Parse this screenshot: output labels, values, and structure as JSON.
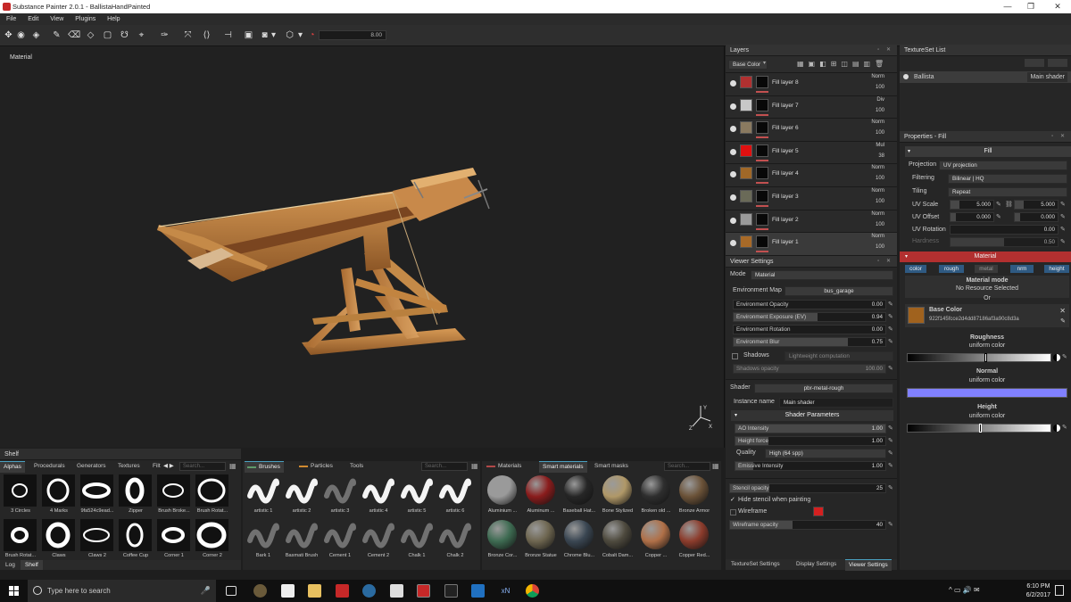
{
  "window": {
    "title": "Substance Painter 2.0.1 - BallistaHandPainted"
  },
  "menu": [
    "File",
    "Edit",
    "View",
    "Plugins",
    "Help"
  ],
  "toolbar": {
    "slider_value": "8.00"
  },
  "viewport": {
    "label": "Material"
  },
  "layers": {
    "title": "Layers",
    "channel": "Base Color",
    "items": [
      {
        "name": "Fill layer 8",
        "blend": "Norm",
        "opacity": "100",
        "color": "#b03030"
      },
      {
        "name": "Fill layer 7",
        "blend": "Div",
        "opacity": "100",
        "color": "#c8c8c8"
      },
      {
        "name": "Fill layer 6",
        "blend": "Norm",
        "opacity": "100",
        "color": "#8a7a60"
      },
      {
        "name": "Fill layer 5",
        "blend": "Mul",
        "opacity": "38",
        "color": "#e01010"
      },
      {
        "name": "Fill layer 4",
        "blend": "Norm",
        "opacity": "100",
        "color": "#a06828"
      },
      {
        "name": "Fill layer 3",
        "blend": "Norm",
        "opacity": "100",
        "color": "#6a6a58"
      },
      {
        "name": "Fill layer 2",
        "blend": "Norm",
        "opacity": "100",
        "color": "#9a9a9a"
      },
      {
        "name": "Fill layer 1",
        "blend": "Norm",
        "opacity": "100",
        "color": "#a86a28"
      }
    ]
  },
  "viewer_settings": {
    "title": "Viewer Settings",
    "mode_label": "Mode",
    "mode_value": "Material",
    "env_map_label": "Environment Map",
    "env_map_value": "bus_garage",
    "env_opacity": {
      "label": "Environment Opacity",
      "value": "0.00"
    },
    "env_exposure": {
      "label": "Environment Exposure (EV)",
      "value": "0.94"
    },
    "env_rotation": {
      "label": "Environment Rotation",
      "value": "0.00"
    },
    "env_blur": {
      "label": "Environment Blur",
      "value": "0.75"
    },
    "shadows_label": "Shadows",
    "shadows_value": "Lightweight computation",
    "shadows_opacity": {
      "label": "Shadows opacity",
      "value": "100.00"
    },
    "shader_label": "Shader",
    "shader_value": "pbr-metal-rough",
    "instance_label": "Instance name",
    "instance_value": "Main shader",
    "shader_params_title": "Shader Parameters",
    "ao_intensity": {
      "label": "AO Intensity",
      "value": "1.00"
    },
    "height_force": {
      "label": "Height force",
      "value": "1.00"
    },
    "quality_label": "Quality",
    "quality_value": "High (64 spp)",
    "emissive": {
      "label": "Emissive Intensity",
      "value": "1.00"
    },
    "stencil_opacity": {
      "label": "Stencil opacity",
      "value": "25"
    },
    "hide_stencil": "Hide stencil when painting",
    "wireframe": "Wireframe",
    "wireframe_opacity": {
      "label": "Wireframe opacity",
      "value": "40"
    },
    "tabs": [
      "TextureSet Settings",
      "Display Settings",
      "Viewer Settings"
    ]
  },
  "texture_set_list": {
    "title": "TextureSet List",
    "item_name": "Ballista",
    "item_shader": "Main shader"
  },
  "properties": {
    "title": "Properties - Fill",
    "fill_section": "Fill",
    "projection_label": "Projection",
    "projection_value": "UV projection",
    "filtering_label": "Filtering",
    "filtering_value": "Bilinear | HQ",
    "tiling_label": "Tiling",
    "tiling_value": "Repeat",
    "uv_scale_label": "UV Scale",
    "uv_scale_a": "5.000",
    "uv_scale_b": "5.000",
    "uv_offset_label": "UV Offset",
    "uv_offset_a": "0.000",
    "uv_offset_b": "0.000",
    "uv_rotation_label": "UV Rotation",
    "uv_rotation_value": "0.00",
    "hardness_label": "Hardness",
    "hardness_value": "0.50",
    "material_section": "Material",
    "channels": [
      "color",
      "rough",
      "metal",
      "nrm",
      "height"
    ],
    "material_mode_title": "Material mode",
    "no_resource": "No Resource Selected",
    "or_text": "Or",
    "base_color_title": "Base Color",
    "base_color_hash": "922f145fcce2d4dd87186af3a90c8d3a",
    "base_color_swatch": "#a0621e",
    "roughness_title": "Roughness",
    "roughness_sub": "uniform color",
    "normal_title": "Normal",
    "normal_sub": "uniform color",
    "normal_color": "#8080ff",
    "height_title": "Height",
    "height_sub": "uniform color"
  },
  "shelf": {
    "title": "Shelf",
    "tabs": [
      "Alphas",
      "Procedurals",
      "Generators",
      "Textures",
      "Filt"
    ],
    "search_placeholder": "Search...",
    "items": [
      "3 Circles",
      "4 Marks",
      "9fa524c9ead...",
      "Zipper",
      "Brush Broke...",
      "Brush Rotat...",
      "Brush Rotat...",
      "Claws",
      "Claws 2",
      "Coffee Cup",
      "Corner 1",
      "Corner 2"
    ]
  },
  "brushes": {
    "tabs": [
      "Brushes",
      "Particles",
      "Tools"
    ],
    "search_placeholder": "Search...",
    "items": [
      "artistic 1",
      "artistic 2",
      "artistic 3",
      "artistic 4",
      "artistic 5",
      "artistic 6",
      "Bark 1",
      "Basmati Brush",
      "Cement 1",
      "Cement 2",
      "Chalk 1",
      "Chalk 2"
    ]
  },
  "materials": {
    "tabs": [
      "Materials",
      "Smart materials",
      "Smart masks"
    ],
    "search_placeholder": "Search...",
    "items": [
      {
        "name": "Aluminium ...",
        "color": "#9a9a9a"
      },
      {
        "name": "Aluminum ...",
        "color": "#8a1c1c"
      },
      {
        "name": "Baseball Hat...",
        "color": "#262626"
      },
      {
        "name": "Bone Stylized",
        "color": "#b09868"
      },
      {
        "name": "Broken old ...",
        "color": "#2e2e2e"
      },
      {
        "name": "Bronze Armor",
        "color": "#6b5238"
      },
      {
        "name": "Bronze Cor...",
        "color": "#3e6b52"
      },
      {
        "name": "Bronze Statue",
        "color": "#6e6650"
      },
      {
        "name": "Chrome Blu...",
        "color": "#3a4652"
      },
      {
        "name": "Cobalt Dam...",
        "color": "#4e4a3e"
      },
      {
        "name": "Copper ...",
        "color": "#b07048"
      },
      {
        "name": "Copper Red...",
        "color": "#8c3c2c"
      }
    ]
  },
  "bottom_tabs": [
    "Log",
    "Shelf"
  ],
  "taskbar": {
    "search_placeholder": "Type here to search",
    "time": "6:10 PM",
    "date": "6/2/2017"
  }
}
